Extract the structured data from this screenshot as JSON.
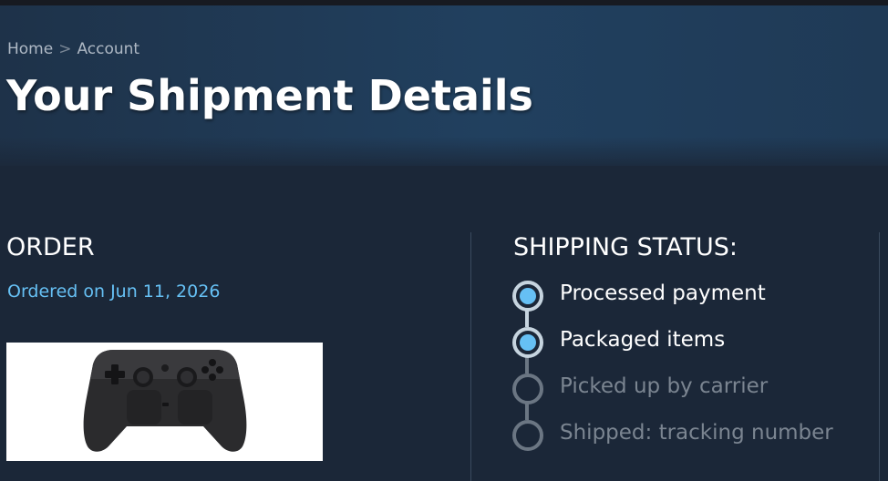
{
  "breadcrumb": {
    "home": "Home",
    "separator": ">",
    "account": "Account"
  },
  "page": {
    "title": "Your Shipment Details"
  },
  "order": {
    "heading": "ORDER",
    "date": "Ordered on Jun 11, 2026",
    "product_image": "game-controller-image"
  },
  "shipping": {
    "heading": "SHIPPING STATUS:",
    "steps": [
      {
        "label": "Processed payment",
        "completed": true
      },
      {
        "label": "Packaged items",
        "completed": true
      },
      {
        "label": "Picked up by carrier",
        "completed": false
      },
      {
        "label": "Shipped: tracking number",
        "completed": false
      }
    ]
  },
  "colors": {
    "background": "#1b2738",
    "accent": "#66c0f4",
    "completed_ring": "#c6d4df",
    "pending_ring": "#6b7683",
    "pending_text": "#7b8591"
  }
}
